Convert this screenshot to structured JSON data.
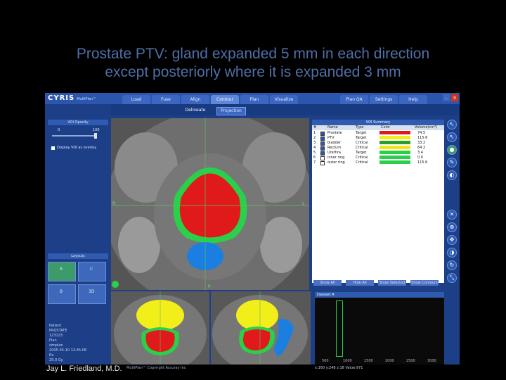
{
  "slide": {
    "title_line1": "Prostate PTV: gland expanded 5 mm in each direction",
    "title_line2": "except posteriorly where it is expanded 3 mm",
    "credit": "Jay L. Friedland, M.D."
  },
  "app": {
    "logo": "CYRIS",
    "logo_sub": "MultiPlan™",
    "tabs": [
      "Load",
      "Fuse",
      "Align",
      "Contour",
      "Plan",
      "Visualize"
    ],
    "right_tabs": [
      "Plan QA",
      "Settings",
      "Help"
    ],
    "active_tab": "Contour",
    "sub_buttons": [
      "Delineate",
      "Projection"
    ],
    "copyright": "MultiPlan™ Copyright Accuray Inc"
  },
  "left_panel": {
    "opacity_title": "VOI Opacity",
    "slider_min": "0",
    "slider_max": "100",
    "display_voi_label": "Display VOI as overlay",
    "layouts_title": "Layouts",
    "layout_labels": [
      "A",
      "C",
      "S",
      "B",
      "3D"
    ],
    "patient_info": [
      "Patient",
      "PROSTATE",
      "123123",
      "Plan",
      "simplan",
      "2005-05-10 12:45:08",
      "Rx",
      "25.0 Gy"
    ]
  },
  "voi_summary": {
    "title": "VOI Summary",
    "columns": [
      "#",
      "",
      "Name",
      "Type",
      "Color",
      "Volume(cm³)"
    ],
    "rows": [
      {
        "num": "1",
        "name": "Prostate",
        "type": "Target",
        "color": "#e01a1a",
        "volume": "74.5"
      },
      {
        "num": "2",
        "name": "PTV",
        "type": "Target",
        "color": "#f2ee1a",
        "volume": "115.6"
      },
      {
        "num": "3",
        "name": "bladder",
        "type": "Critical",
        "color": "#2aa02a",
        "volume": "33.2"
      },
      {
        "num": "4",
        "name": "Rectum",
        "type": "Critical",
        "color": "#f4e41a",
        "volume": "64.2"
      },
      {
        "num": "5",
        "name": "Urethra",
        "type": "Target",
        "color": "#2ad04a",
        "volume": "3.4"
      },
      {
        "num": "6",
        "name": "inner ring",
        "type": "Critical",
        "color": "#2ad04a",
        "volume": "0.0"
      },
      {
        "num": "7",
        "name": "outer ring",
        "type": "Critical",
        "color": "#2ad04a",
        "volume": "115.6"
      }
    ],
    "buttons": [
      "Show All",
      "Hide All",
      "Show Selected",
      "Show Contours"
    ]
  },
  "dataset": {
    "label": "Dataset A",
    "hist_ticks": [
      "500",
      "1000",
      "1500",
      "2000",
      "2500",
      "3000"
    ],
    "status": "x:160  y:248  z:18  Value:971"
  },
  "views": {
    "axial_label": "A",
    "markers": [
      "P",
      "L",
      "R",
      "S"
    ]
  },
  "colors": {
    "prostate": "#e01a1a",
    "ptv": "#f2ee1a",
    "ring": "#2ad04a",
    "rectum": "#1a7fe0",
    "bladder": "#f2ee1a"
  }
}
